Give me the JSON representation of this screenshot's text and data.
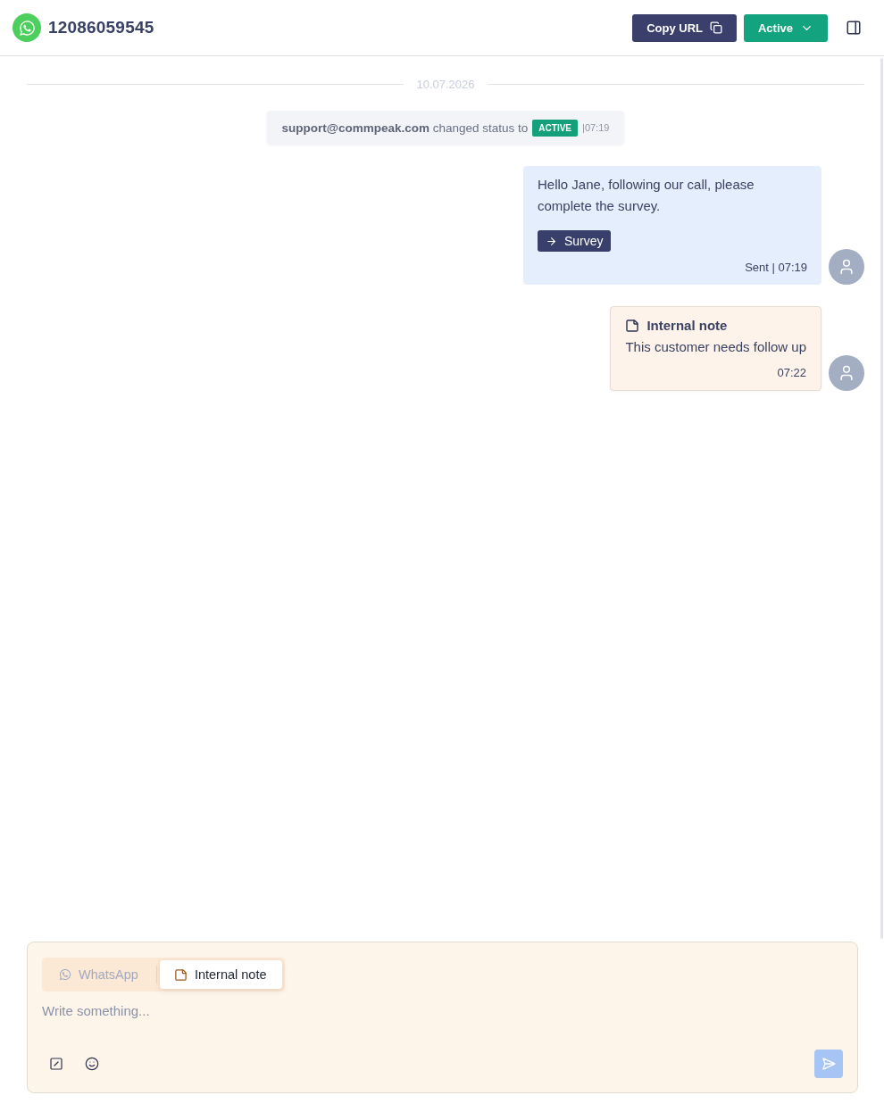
{
  "header": {
    "title": "12086059545",
    "copy_button": "Copy URL",
    "status_button": "Active"
  },
  "feed": {
    "date": "10.07.2026",
    "items": [
      {
        "kind": "status_change",
        "text": "**support@commpeak.com** changed status to",
        "badge": "ACTIVE",
        "time": "|07:19"
      },
      {
        "kind": "message",
        "text": "Hello Jane, following our call, please complete the survey.",
        "button": "Survey",
        "status": "Sent | 07:19"
      },
      {
        "kind": "note",
        "title": "Internal note",
        "text": "This customer needs follow up",
        "time": "07:22"
      }
    ]
  },
  "composer": {
    "tabs": [
      {
        "kind": "whatsapp",
        "label": "WhatsApp",
        "selected": false
      },
      {
        "kind": "note",
        "label": "Internal note",
        "selected": true
      }
    ],
    "placeholder": "Write something...",
    "send_disabled": true
  }
}
